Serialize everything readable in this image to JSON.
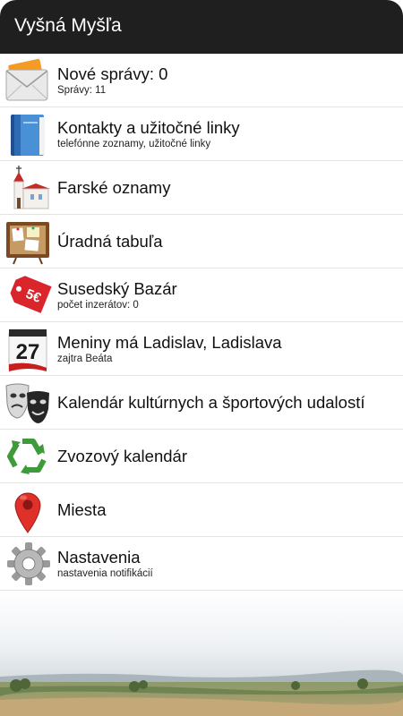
{
  "header": {
    "title": "Vyšná Myšľa"
  },
  "menu": [
    {
      "label": "Nové správy: 0",
      "sub": "Správy: 11",
      "icon": "envelope-icon"
    },
    {
      "label": "Kontakty a užitočné linky",
      "sub": "telefónne zoznamy, užitočné linky",
      "icon": "address-book-icon"
    },
    {
      "label": "Farské oznamy",
      "sub": "",
      "icon": "church-icon"
    },
    {
      "label": "Úradná tabuľa",
      "sub": "",
      "icon": "corkboard-icon"
    },
    {
      "label": "Susedský Bazár",
      "sub": "počet inzerátov: 0",
      "icon": "price-tag-icon",
      "badge": "5€"
    },
    {
      "label": "Meniny má Ladislav, Ladislava",
      "sub": "zajtra Beáta",
      "icon": "calendar-icon",
      "day": "27"
    },
    {
      "label": "Kalendár kultúrnych a športových udalostí",
      "sub": "",
      "icon": "theater-masks-icon"
    },
    {
      "label": "Zvozový kalendár",
      "sub": "",
      "icon": "recycle-icon"
    },
    {
      "label": "Miesta",
      "sub": "",
      "icon": "map-pin-icon"
    },
    {
      "label": "Nastavenia",
      "sub": "nastavenia notifikácií",
      "icon": "gear-icon"
    }
  ],
  "colors": {
    "titlebar": "#1f1f1f",
    "divider": "#e3e3e3",
    "accent_red": "#d9262c",
    "recycle_green": "#3e9a3a"
  }
}
